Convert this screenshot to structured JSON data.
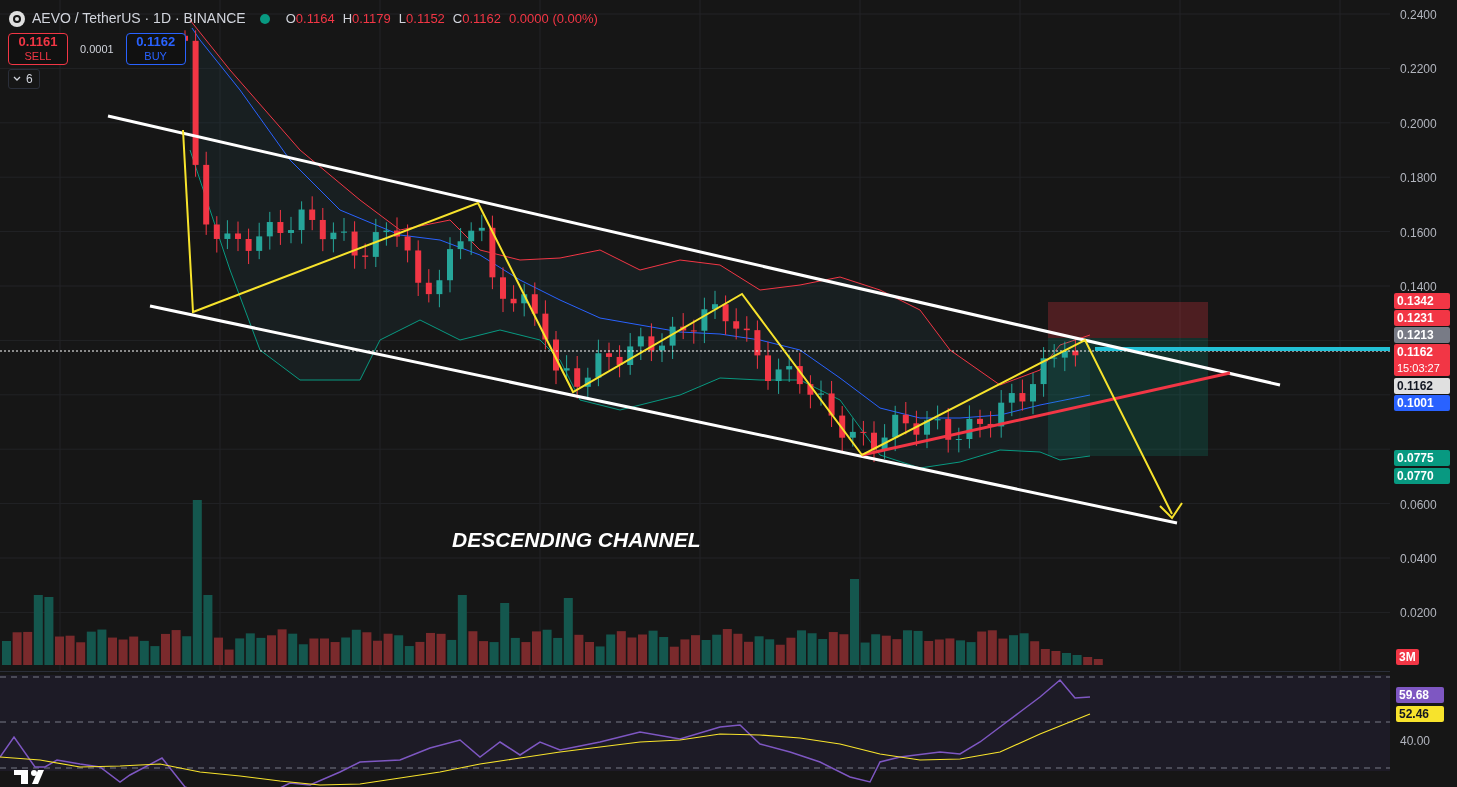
{
  "header": {
    "symbol": "AEVO / TetherUS · 1D · BINANCE",
    "market_open": true,
    "ohlc": [
      {
        "label": "O",
        "value": "0.1164"
      },
      {
        "label": "H",
        "value": "0.1179"
      },
      {
        "label": "L",
        "value": "0.1152"
      },
      {
        "label": "C",
        "value": "0.1162"
      }
    ],
    "change": "0.0000 (0.00%)"
  },
  "trade": {
    "sell_price": "0.1161",
    "sell_label": "SELL",
    "spread": "0.0001",
    "buy_price": "0.1162",
    "buy_label": "BUY"
  },
  "indicators_toggle": {
    "count": "6",
    "expanded": false
  },
  "annotation": "DESCENDING CHANNEL",
  "price_axis": {
    "ticks": [
      "0.2400",
      "0.2200",
      "0.2000",
      "0.1800",
      "0.1600",
      "0.1400",
      "0.0600",
      "0.0400",
      "0.0200"
    ],
    "badges": [
      {
        "value": "0.1342",
        "color": "#f23645"
      },
      {
        "value": "0.1231",
        "color": "#f23645"
      },
      {
        "value": "0.1213",
        "color": "#787b86"
      },
      {
        "value": "0.1162",
        "sub": "15:03:27",
        "color": "#f23645"
      },
      {
        "value": "0.1162",
        "color": "#e0e0e0"
      },
      {
        "value": "0.1001",
        "color": "#2962ff"
      },
      {
        "value": "0.0775",
        "color": "#089981"
      },
      {
        "value": "0.0770",
        "color": "#089981"
      }
    ],
    "volume_badge": {
      "value": "3M",
      "color": "#f23645"
    }
  },
  "rsi_axis": {
    "badges": [
      {
        "value": "59.68",
        "color": "#7e57c2"
      },
      {
        "value": "52.46",
        "color": "#f7e32c"
      }
    ],
    "ticks": [
      "40.00"
    ]
  }
}
